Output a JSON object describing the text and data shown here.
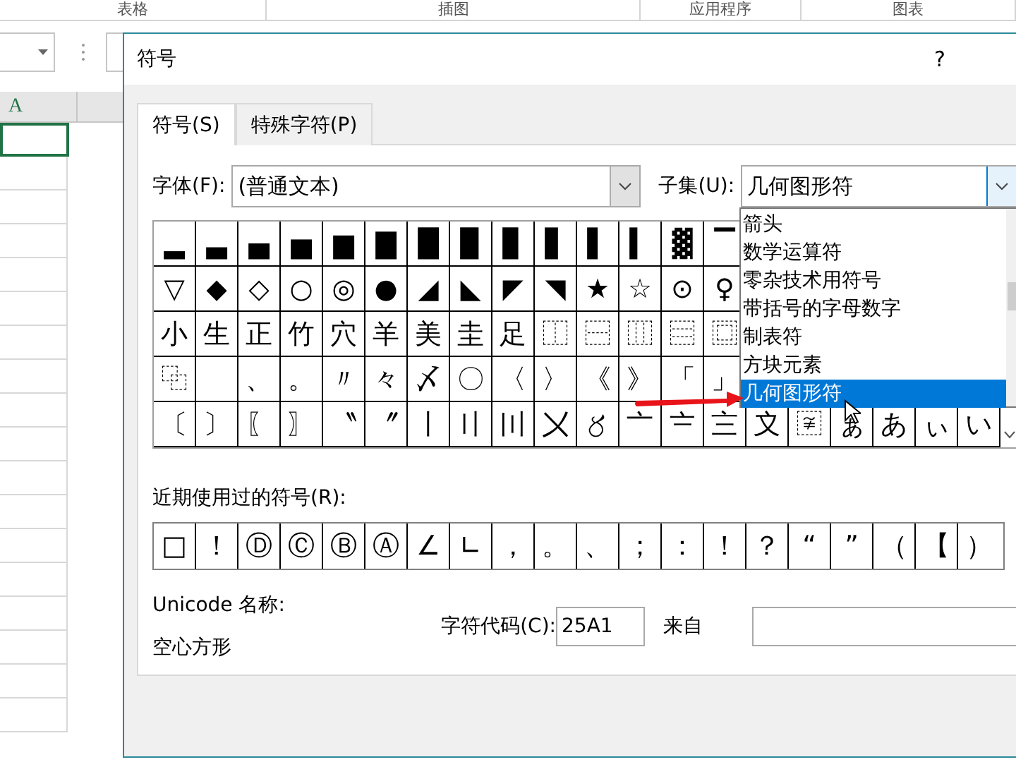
{
  "ribbon_groups": [
    "表格",
    "插图",
    "应用程序",
    "图表"
  ],
  "sheet": {
    "column_header": "A"
  },
  "dialog": {
    "title": "符号",
    "help_button": "?",
    "tabs": [
      {
        "label": "符号(S)",
        "selected": true
      },
      {
        "label": "特殊字符(P)",
        "selected": false
      }
    ],
    "font": {
      "label": "字体(F):",
      "value": "(普通文本)"
    },
    "subset": {
      "label": "子集(U):",
      "value": "几何图形符",
      "expanded": true,
      "options": [
        {
          "label": "箭头",
          "selected": false
        },
        {
          "label": "数学运算符",
          "selected": false
        },
        {
          "label": "零杂技术用符号",
          "selected": false
        },
        {
          "label": "带括号的字母数字",
          "selected": false
        },
        {
          "label": "制表符",
          "selected": false
        },
        {
          "label": "方块元素",
          "selected": false
        },
        {
          "label": "几何图形符",
          "selected": true
        }
      ]
    },
    "symbol_rows": [
      [
        "▂",
        "▃",
        "▄",
        "▅",
        "▆",
        "▇",
        "█",
        "▉",
        "▊",
        "▋",
        "▌",
        "▍",
        "▓",
        "▔"
      ],
      [
        "▽",
        "◆",
        "◇",
        "○",
        "◎",
        "●",
        "◢",
        "◣",
        "◤",
        "◥",
        "★",
        "☆",
        "⊙",
        "♀"
      ],
      [
        "小",
        "生",
        "正",
        "竹",
        "穴",
        "羊",
        "美",
        "圭",
        "足",
        "⿰",
        "⿱",
        "⿲",
        "⿳",
        "⿴"
      ],
      [
        "⿻",
        null,
        "、",
        "。",
        "〃",
        "々",
        "〆",
        "〇",
        "〈",
        "〉",
        "《",
        "》",
        "「",
        "」"
      ],
      [
        "〔",
        "〕",
        "〖",
        "〗",
        "〝",
        "〞",
        "〡",
        "〢",
        "〣",
        "〤",
        "〥",
        "〦",
        "〧",
        "〨",
        "〩",
        "〾",
        "ぁ",
        "あ",
        "ぃ",
        "い"
      ]
    ],
    "recent_label": "近期使用过的符号(R):",
    "recent_symbols": [
      "□",
      "！",
      "Ⓓ",
      "Ⓒ",
      "Ⓑ",
      "Ⓐ",
      "∠",
      "∟",
      "，",
      "。",
      "、",
      "；",
      "：",
      "！",
      "？",
      "“",
      "”",
      "（",
      "【",
      "）"
    ],
    "unicode_name_label": "Unicode 名称:",
    "unicode_name": "空心方形",
    "char_code_label": "字符代码(C):",
    "char_code": "25A1",
    "from_label": "来自"
  }
}
